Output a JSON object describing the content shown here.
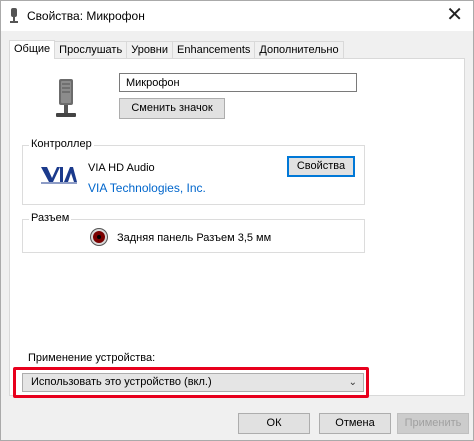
{
  "window": {
    "title": "Свойства: Микрофон",
    "close_glyph": "✕"
  },
  "tabs": [
    {
      "label": "Общие",
      "active": true
    },
    {
      "label": "Прослушать",
      "active": false
    },
    {
      "label": "Уровни",
      "active": false
    },
    {
      "label": "Enhancements",
      "active": false
    },
    {
      "label": "Дополнительно",
      "active": false
    }
  ],
  "general": {
    "device_name": "Микрофон",
    "change_icon_label": "Сменить значок"
  },
  "controller": {
    "group_label": "Контроллер",
    "name": "VIA HD Audio",
    "vendor": "VIA Technologies, Inc.",
    "properties_label": "Свойства",
    "logo_text": "VIA"
  },
  "jack": {
    "group_label": "Разъем",
    "description": "Задняя панель Разъем 3,5 мм",
    "color": "#7a0000"
  },
  "usage": {
    "label": "Применение устройства:",
    "selected": "Использовать это устройство (вкл.)"
  },
  "footer": {
    "ok": "ОК",
    "cancel": "Отмена",
    "apply": "Применить"
  },
  "colors": {
    "highlight": "#e8001d",
    "link": "#0066cc",
    "accent": "#0078d7"
  }
}
